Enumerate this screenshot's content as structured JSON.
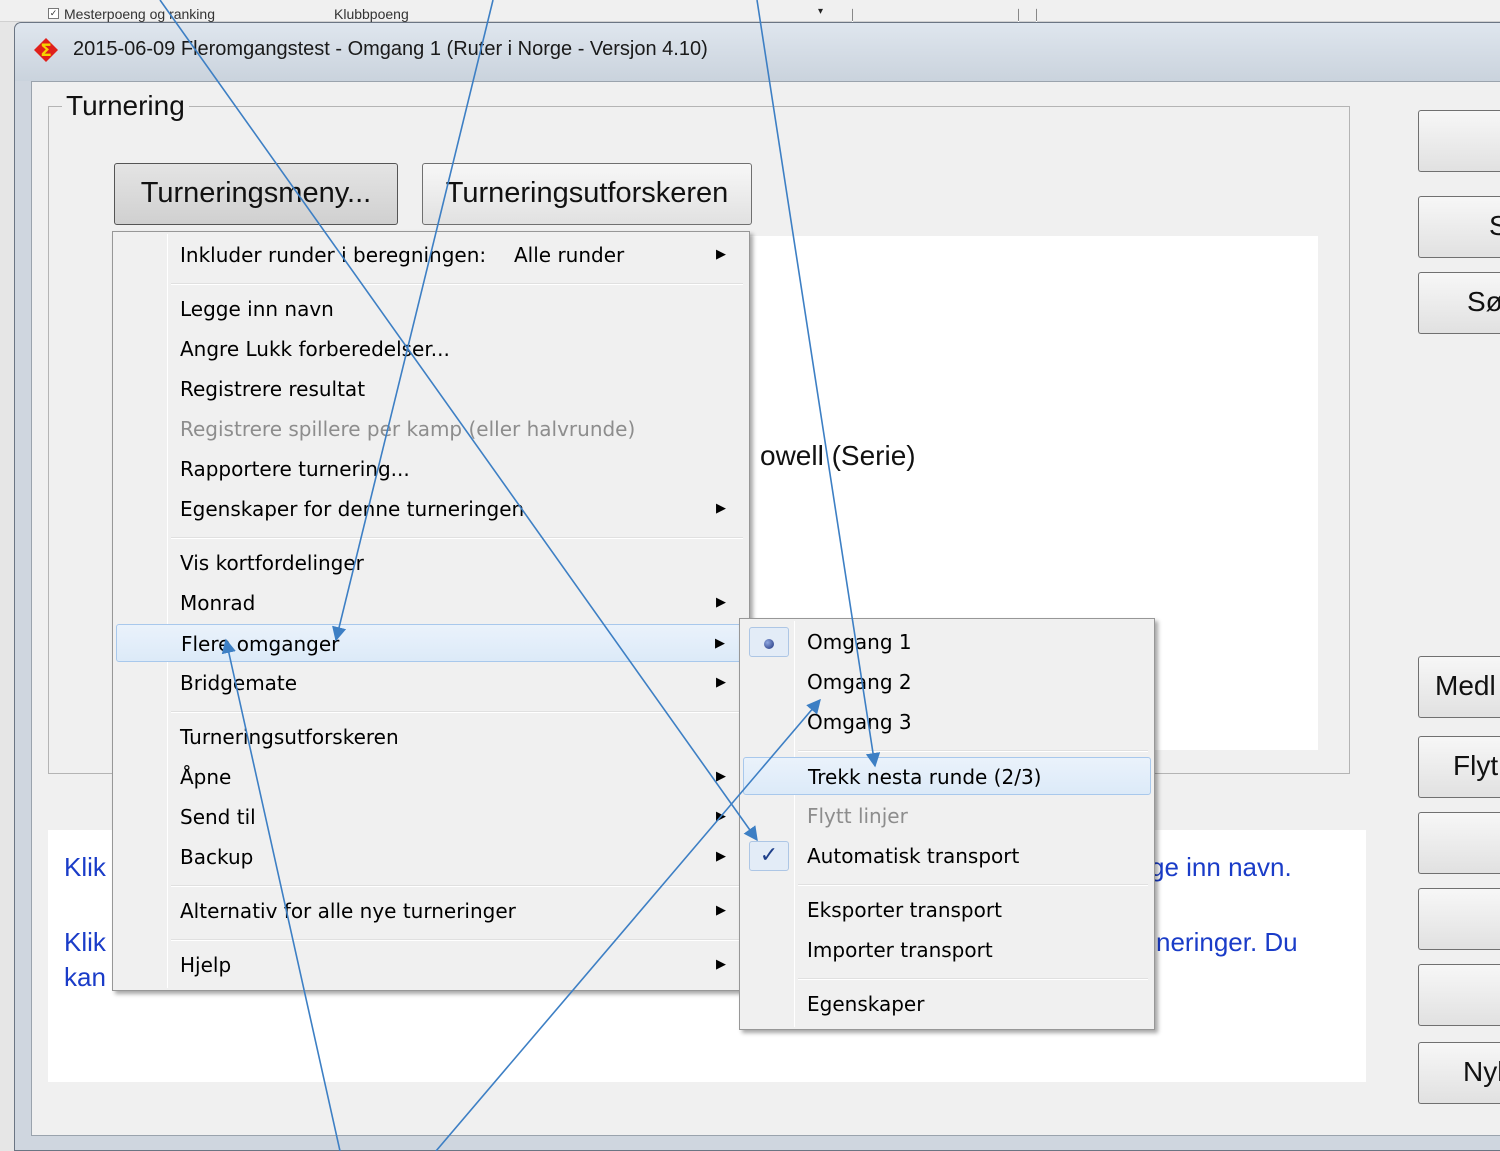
{
  "background": {
    "strip_left": "Mesterpoeng og ranking",
    "strip_middle": "Klubbpoeng",
    "dropdown": "▾"
  },
  "window": {
    "title": "2015-06-09  Fleromgangstest - Omgang 1  (Ruter i Norge - Versjon 4.10)"
  },
  "group": {
    "legend": "Turnering",
    "menu_button": "Turneringsmeny...",
    "explorer_button": "Turneringsutforskeren",
    "info_text": "owell (Serie)"
  },
  "right_buttons": [
    "",
    "S",
    "Sø",
    "Medl",
    "Flyt",
    "",
    "",
    "",
    "Nyl"
  ],
  "help": {
    "line1_start": "Klik",
    "line1_end": "ge inn navn.",
    "line2_start": "Klik",
    "line2_end": "neringer. Du",
    "line3_start": "kan"
  },
  "main_menu": {
    "include_label": "Inkluder runder i beregningen:",
    "include_value": "Alle runder",
    "items": [
      "Legge inn navn",
      "Angre Lukk forberedelser...",
      "Registrere resultat",
      "Registrere spillere per kamp (eller halvrunde)",
      "Rapportere turnering...",
      "Egenskaper for denne turneringen",
      "Vis kortfordelinger",
      "Monrad",
      "Flere omganger",
      "Bridgemate",
      "Turneringsutforskeren",
      "Åpne",
      "Send til",
      "Backup",
      "Alternativ for alle nye turneringer",
      "Hjelp"
    ]
  },
  "sub_menu": {
    "items": [
      "Omgang 1",
      "Omgang 2",
      "Omgang 3",
      "Trekk nesta runde (2/3)",
      "Flytt linjer",
      "Automatisk transport",
      "Eksporter transport",
      "Importer transport",
      "Egenskaper"
    ],
    "check_mark": "✓"
  },
  "colors": {
    "highlight_border": "#a8c8ec",
    "help_text": "#1a3cc8",
    "annotation_arrows": "#3d7fc4"
  }
}
